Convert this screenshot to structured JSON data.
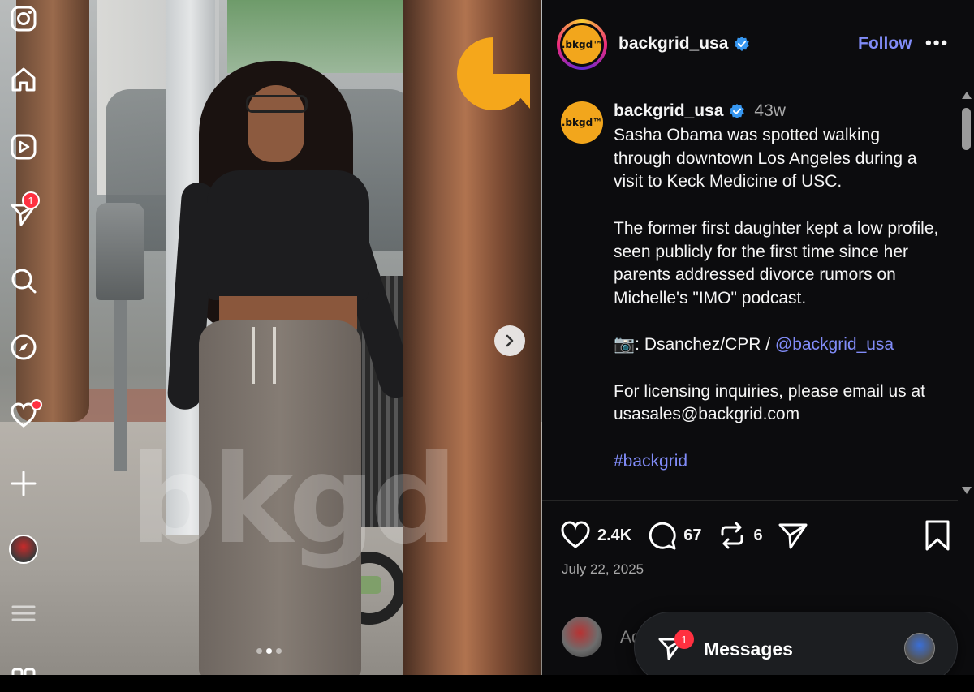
{
  "post": {
    "username": "backgrid_usa",
    "follow_label": "Follow",
    "more_label": "•••",
    "brand_text": ".bkgd™",
    "watermark": "bkgd",
    "time_ago": "43w",
    "caption_paragraphs": [
      "Sasha Obama was spotted walking through downtown Los Angeles during a visit to Keck Medicine of USC.",
      "The former first daughter kept a low profile, seen publicly for the first time since her parents addressed divorce rumors on Michelle's \"IMO\" podcast."
    ],
    "credit_prefix": "📷: Dsanchez/CPR / ",
    "credit_mention": "@backgrid_usa",
    "licensing_text": "For licensing inquiries, please email us at usasales@backgrid.com",
    "hashtag": "#backgrid",
    "likes": "2.4K",
    "comments": "67",
    "reposts": "6",
    "date": "July 22, 2025",
    "comment_placeholder": "Ad"
  },
  "nav": {
    "notifications_badge": "1"
  },
  "messages": {
    "label": "Messages",
    "badge": "1"
  },
  "colors": {
    "accent_link": "#818cf8",
    "badge_red": "#ff3040",
    "brand_orange": "#f2a61c",
    "panel_bg": "#0c0c0e"
  },
  "icons": [
    "instagram-icon",
    "home-icon",
    "reels-icon",
    "direct-icon",
    "search-icon",
    "explore-icon",
    "heart-icon",
    "create-icon",
    "menu-icon",
    "more-apps-icon",
    "verified-icon",
    "like-icon",
    "comment-icon",
    "repost-icon",
    "share-icon",
    "bookmark-icon",
    "chevron-right-icon"
  ],
  "carousel": {
    "total_slides": 2,
    "active_slide": 2
  }
}
